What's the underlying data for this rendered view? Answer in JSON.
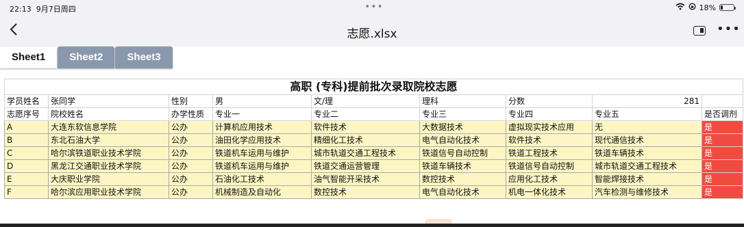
{
  "status": {
    "time": "22:13",
    "date": "9月7日周四",
    "battery": "18%",
    "battery_level": 0.18
  },
  "nav": {
    "title": "志愿.xlsx"
  },
  "sheet_tabs": [
    "Sheet1",
    "Sheet2",
    "Sheet3"
  ],
  "active_tab": 0,
  "table": {
    "title": "高职 (专科)提前批次录取院校志愿",
    "info_row": [
      "学员姓名",
      "张同学",
      "性别",
      "男",
      "文/理",
      "理科",
      "分数",
      "281"
    ],
    "header_row": [
      "志愿序号",
      "院校姓名",
      "办学性质",
      "专业一",
      "专业二",
      "专业三",
      "专业四",
      "专业五",
      "是否调剂"
    ],
    "rows": [
      [
        "A",
        "大连东软信息学院",
        "公办",
        "计算机应用技术",
        "软件技术",
        "大数据技术",
        "虚拟现实技术应用",
        "无",
        "是"
      ],
      [
        "B",
        "东北石油大学",
        "公办",
        "油田化学应用技术",
        "精细化工技术",
        "电气自动化技术",
        "软件技术",
        "现代通信技术",
        "是"
      ],
      [
        "C",
        "哈尔滨铁道职业技术学院",
        "公办",
        "铁道机车运用与维护",
        "城市轨道交通工程技术",
        "铁道信号自动控制",
        "铁道工程技术",
        "铁道车辆技术",
        "是"
      ],
      [
        "D",
        "黑龙江交通职业技术学院",
        "公办",
        "铁道机车运用与维护",
        "铁道交通运营管理",
        "铁道车辆技术",
        "铁道信号自动控制",
        "城市轨道交通工程技术",
        "是"
      ],
      [
        "E",
        "大庆职业学院",
        "公办",
        "石油化工技术",
        "油气智能开采技术",
        "数控技术",
        "应用化工技术",
        "智能焊接技术",
        "是"
      ],
      [
        "F",
        "哈尔滨应用职业技术学院",
        "公办",
        "机械制造及自动化",
        "数控技术",
        "电气自动化技术",
        "机电一体化技术",
        "汽车检测与维修技术",
        "是"
      ]
    ]
  },
  "colors": {
    "accent_red": "#f14a41",
    "row_yellow": "#fdf6c4",
    "tab_inactive": "#8a98ad"
  }
}
